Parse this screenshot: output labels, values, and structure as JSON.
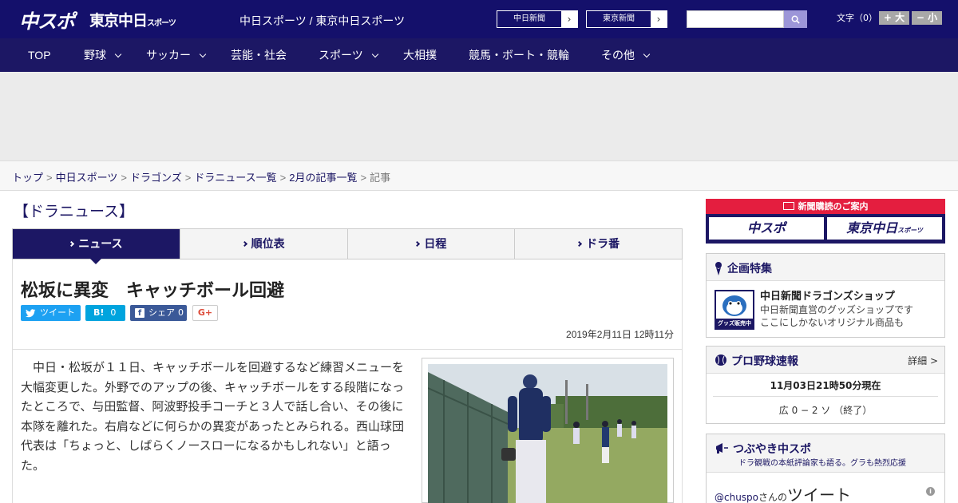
{
  "header": {
    "logo_main": "中スポ",
    "logo_tokyo": "東京中日",
    "logo_tokyo_sub": "スポーツ",
    "site_name": "中日スポーツ / 東京中日スポーツ",
    "paper_links": [
      "中日新聞",
      "東京新聞"
    ],
    "font_size_label": "文字（0）",
    "font_larger": "+ 大",
    "font_smaller": "− 小"
  },
  "nav": {
    "items": [
      {
        "label": "TOP",
        "dropdown": false
      },
      {
        "label": "野球",
        "dropdown": true
      },
      {
        "label": "サッカー",
        "dropdown": true
      },
      {
        "label": "芸能・社会",
        "dropdown": false
      },
      {
        "label": "スポーツ",
        "dropdown": true
      },
      {
        "label": "大相撲",
        "dropdown": false
      },
      {
        "label": "競馬・ボート・競輪",
        "dropdown": false
      },
      {
        "label": "その他",
        "dropdown": true
      }
    ]
  },
  "breadcrumb": {
    "items": [
      "トップ",
      "中日スポーツ",
      "ドラゴンズ",
      "ドラニュース一覧",
      "2月の記事一覧"
    ],
    "current": "記事"
  },
  "main": {
    "section_title": "【ドラニュース】",
    "tabs": [
      "ニュース",
      "順位表",
      "日程",
      "ドラ番"
    ],
    "headline": "松坂に異変　キャッチボール回避",
    "share": {
      "tweet": "ツイート",
      "hatena_label": "B!",
      "hatena_count": "0",
      "facebook": "シェア",
      "facebook_count": "0",
      "gplus": "G+"
    },
    "timestamp": "2019年2月11日 12時11分",
    "body": "　中日・松坂が１１日、キャッチボールを回避するなど練習メニューを大幅変更した。外野でのアップの後、キャッチボールをする段階になったところで、与田監督、阿波野投手コーチと３人で話し合い、その後に本隊を離れた。右肩などに何らかの異変があったとみられる。西山球団代表は「ちょっと、しばらくノースローになるかもしれない」と語った。"
  },
  "sidebar": {
    "subscribe_label": "新聞購読のご案内",
    "subscribe_logos": [
      "中スポ",
      "東京中日"
    ],
    "subscribe_logo_sub": "スポーツ",
    "special": {
      "title": "企画特集",
      "shop_title": "中日新聞ドラゴンズショップ",
      "shop_desc_1": "中日新聞直営のグッズショップです",
      "shop_desc_2": "ここにしかないオリジナル商品も",
      "thumb_label": "グッズ販売中"
    },
    "scores": {
      "title": "プロ野球速報",
      "detail": "詳細 >",
      "time": "11月03日21時50分現在",
      "line": "広 0 − 2 ソ （終了）"
    },
    "tweets": {
      "title": "つぶやき中スポ",
      "subtitle": "ドラ観戦の本紙評論家も語る。グラも熱烈応援",
      "handle": "@chuspo",
      "suffix": "さんの",
      "label": "ツイート"
    }
  },
  "colors": {
    "brand_navy": "#14106b",
    "nav_navy": "#1c1764",
    "subscribe_red": "#e41e3f",
    "twitter_blue": "#1da1f2",
    "hatena_blue": "#00a4de",
    "facebook_blue": "#3b5998"
  }
}
